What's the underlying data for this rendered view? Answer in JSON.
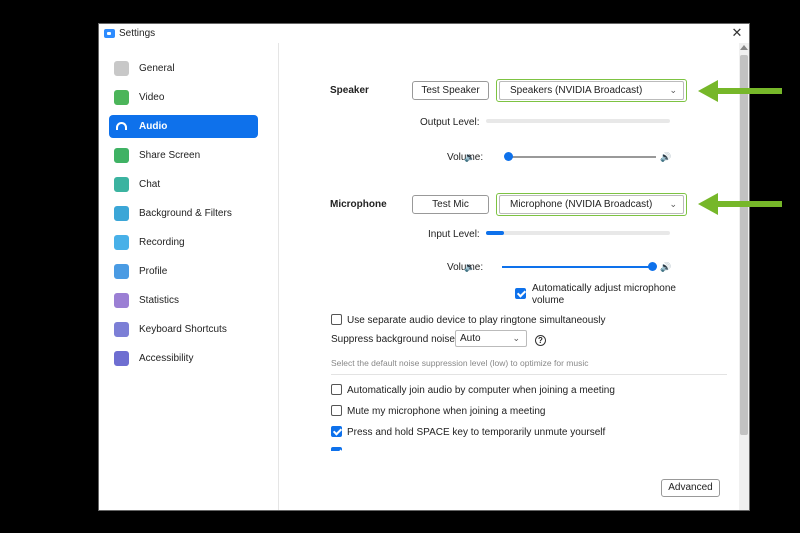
{
  "window": {
    "title": "Settings",
    "close_glyph": "✕"
  },
  "sidebar": {
    "items": [
      {
        "label": "General",
        "icon": "gear-icon",
        "color": "#c8c8c8",
        "active": false
      },
      {
        "label": "Video",
        "icon": "video-icon",
        "color": "#4cb55a",
        "active": false
      },
      {
        "label": "Audio",
        "icon": "headphones-icon",
        "color": "#ffffff",
        "active": true
      },
      {
        "label": "Share Screen",
        "icon": "share-screen-icon",
        "color": "#3fb264",
        "active": false
      },
      {
        "label": "Chat",
        "icon": "chat-icon",
        "color": "#3bb3a0",
        "active": false
      },
      {
        "label": "Background & Filters",
        "icon": "background-icon",
        "color": "#3ba6d7",
        "active": false
      },
      {
        "label": "Recording",
        "icon": "recording-icon",
        "color": "#48b0e8",
        "active": false
      },
      {
        "label": "Profile",
        "icon": "profile-icon",
        "color": "#4a9be3",
        "active": false
      },
      {
        "label": "Statistics",
        "icon": "statistics-icon",
        "color": "#9b7fd4",
        "active": false
      },
      {
        "label": "Keyboard Shortcuts",
        "icon": "keyboard-icon",
        "color": "#7c7fd6",
        "active": false
      },
      {
        "label": "Accessibility",
        "icon": "accessibility-icon",
        "color": "#6e6ed1",
        "active": false
      }
    ]
  },
  "speaker": {
    "label": "Speaker",
    "test_button": "Test Speaker",
    "device": "Speakers (NVIDIA Broadcast)",
    "output_level_label": "Output Level:",
    "output_level": 0.0,
    "volume_label": "Volume:",
    "volume": 0.0
  },
  "microphone": {
    "label": "Microphone",
    "test_button": "Test Mic",
    "device": "Microphone (NVIDIA Broadcast)",
    "input_level_label": "Input Level:",
    "input_level": 0.1,
    "volume_label": "Volume:",
    "volume": 1.0,
    "auto_adjust_label_1": "Automatically adjust microphone",
    "auto_adjust_label_2": "volume",
    "auto_adjust": true
  },
  "options": {
    "separate_device_label": "Use separate audio device to play ringtone simultaneously",
    "separate_device": false,
    "suppress_label": "Suppress background noise",
    "suppress_value": "Auto",
    "suppress_hint": "Select the default noise suppression level (low) to optimize for music",
    "help_glyph": "?",
    "auto_join_label": "Automatically join audio by computer when joining a meeting",
    "auto_join": false,
    "mute_label": "Mute my microphone when joining a meeting",
    "mute": false,
    "space_label": "Press and hold SPACE key to temporarily unmute yourself",
    "space": true
  },
  "advanced_button": "Advanced",
  "colors": {
    "accent": "#0e71eb",
    "highlight_arrow": "#76b729",
    "highlight_outline": "#7dc342"
  }
}
